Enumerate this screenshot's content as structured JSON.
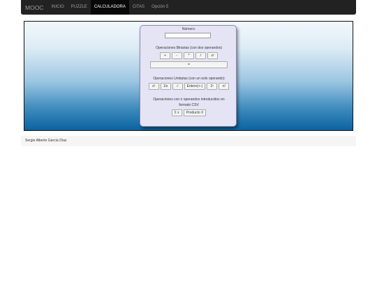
{
  "nav": {
    "brand": "MOOC",
    "links": [
      "INICIO",
      "PUZZLE",
      "CALCULADORA",
      "CITAS",
      "Opción 5"
    ]
  },
  "calculator": {
    "number_label": "Número:",
    "number_value": "",
    "binary_title": "Operaciones Binarias (con dos operandos)",
    "binary_ops": [
      "+",
      "-",
      "*",
      "/",
      "xʸ"
    ],
    "equals_label": "=",
    "unary_title": "Operaciones Unitarias (con un solo operando)",
    "unary_ops": [
      "x²",
      "1/x",
      "√",
      "Entero(+-)",
      "2ⁿ",
      "n!"
    ],
    "nary_title_line1": "Operaciones con n operandos introducidos en",
    "nary_title_line2": "formato CSV",
    "nary_ops": [
      "Σ x",
      "Producto X"
    ]
  },
  "footer": {
    "author": "Sergio Alberto García Díaz"
  }
}
